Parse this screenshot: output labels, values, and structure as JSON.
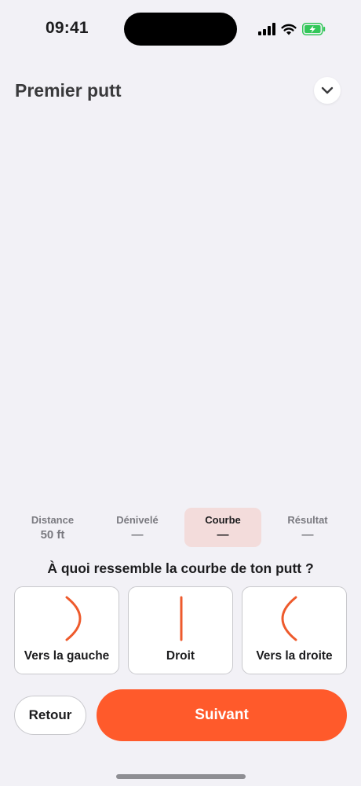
{
  "status_bar": {
    "time": "09:41",
    "icons": [
      "cellular-signal-icon",
      "wifi-icon",
      "battery-charging-icon"
    ],
    "battery_color": "#33c759"
  },
  "header": {
    "title": "Premier putt",
    "collapse_icon": "chevron-down-icon"
  },
  "steps": [
    {
      "label": "Distance",
      "value": "50 ft",
      "active": false
    },
    {
      "label": "Dénivelé",
      "value": "—",
      "active": false
    },
    {
      "label": "Courbe",
      "value": "—",
      "active": true
    },
    {
      "label": "Résultat",
      "value": "—",
      "active": false
    }
  ],
  "question": "À quoi ressemble la courbe de ton putt ?",
  "options": [
    {
      "label": "Vers la gauche",
      "icon": "curve-left-icon"
    },
    {
      "label": "Droit",
      "icon": "straight-line-icon"
    },
    {
      "label": "Vers la droite",
      "icon": "curve-right-icon"
    }
  ],
  "buttons": {
    "back": "Retour",
    "next": "Suivant"
  },
  "colors": {
    "accent": "#ff5a2b",
    "background": "#f2f1f6",
    "active_step_bg": "#f3dcdb"
  }
}
